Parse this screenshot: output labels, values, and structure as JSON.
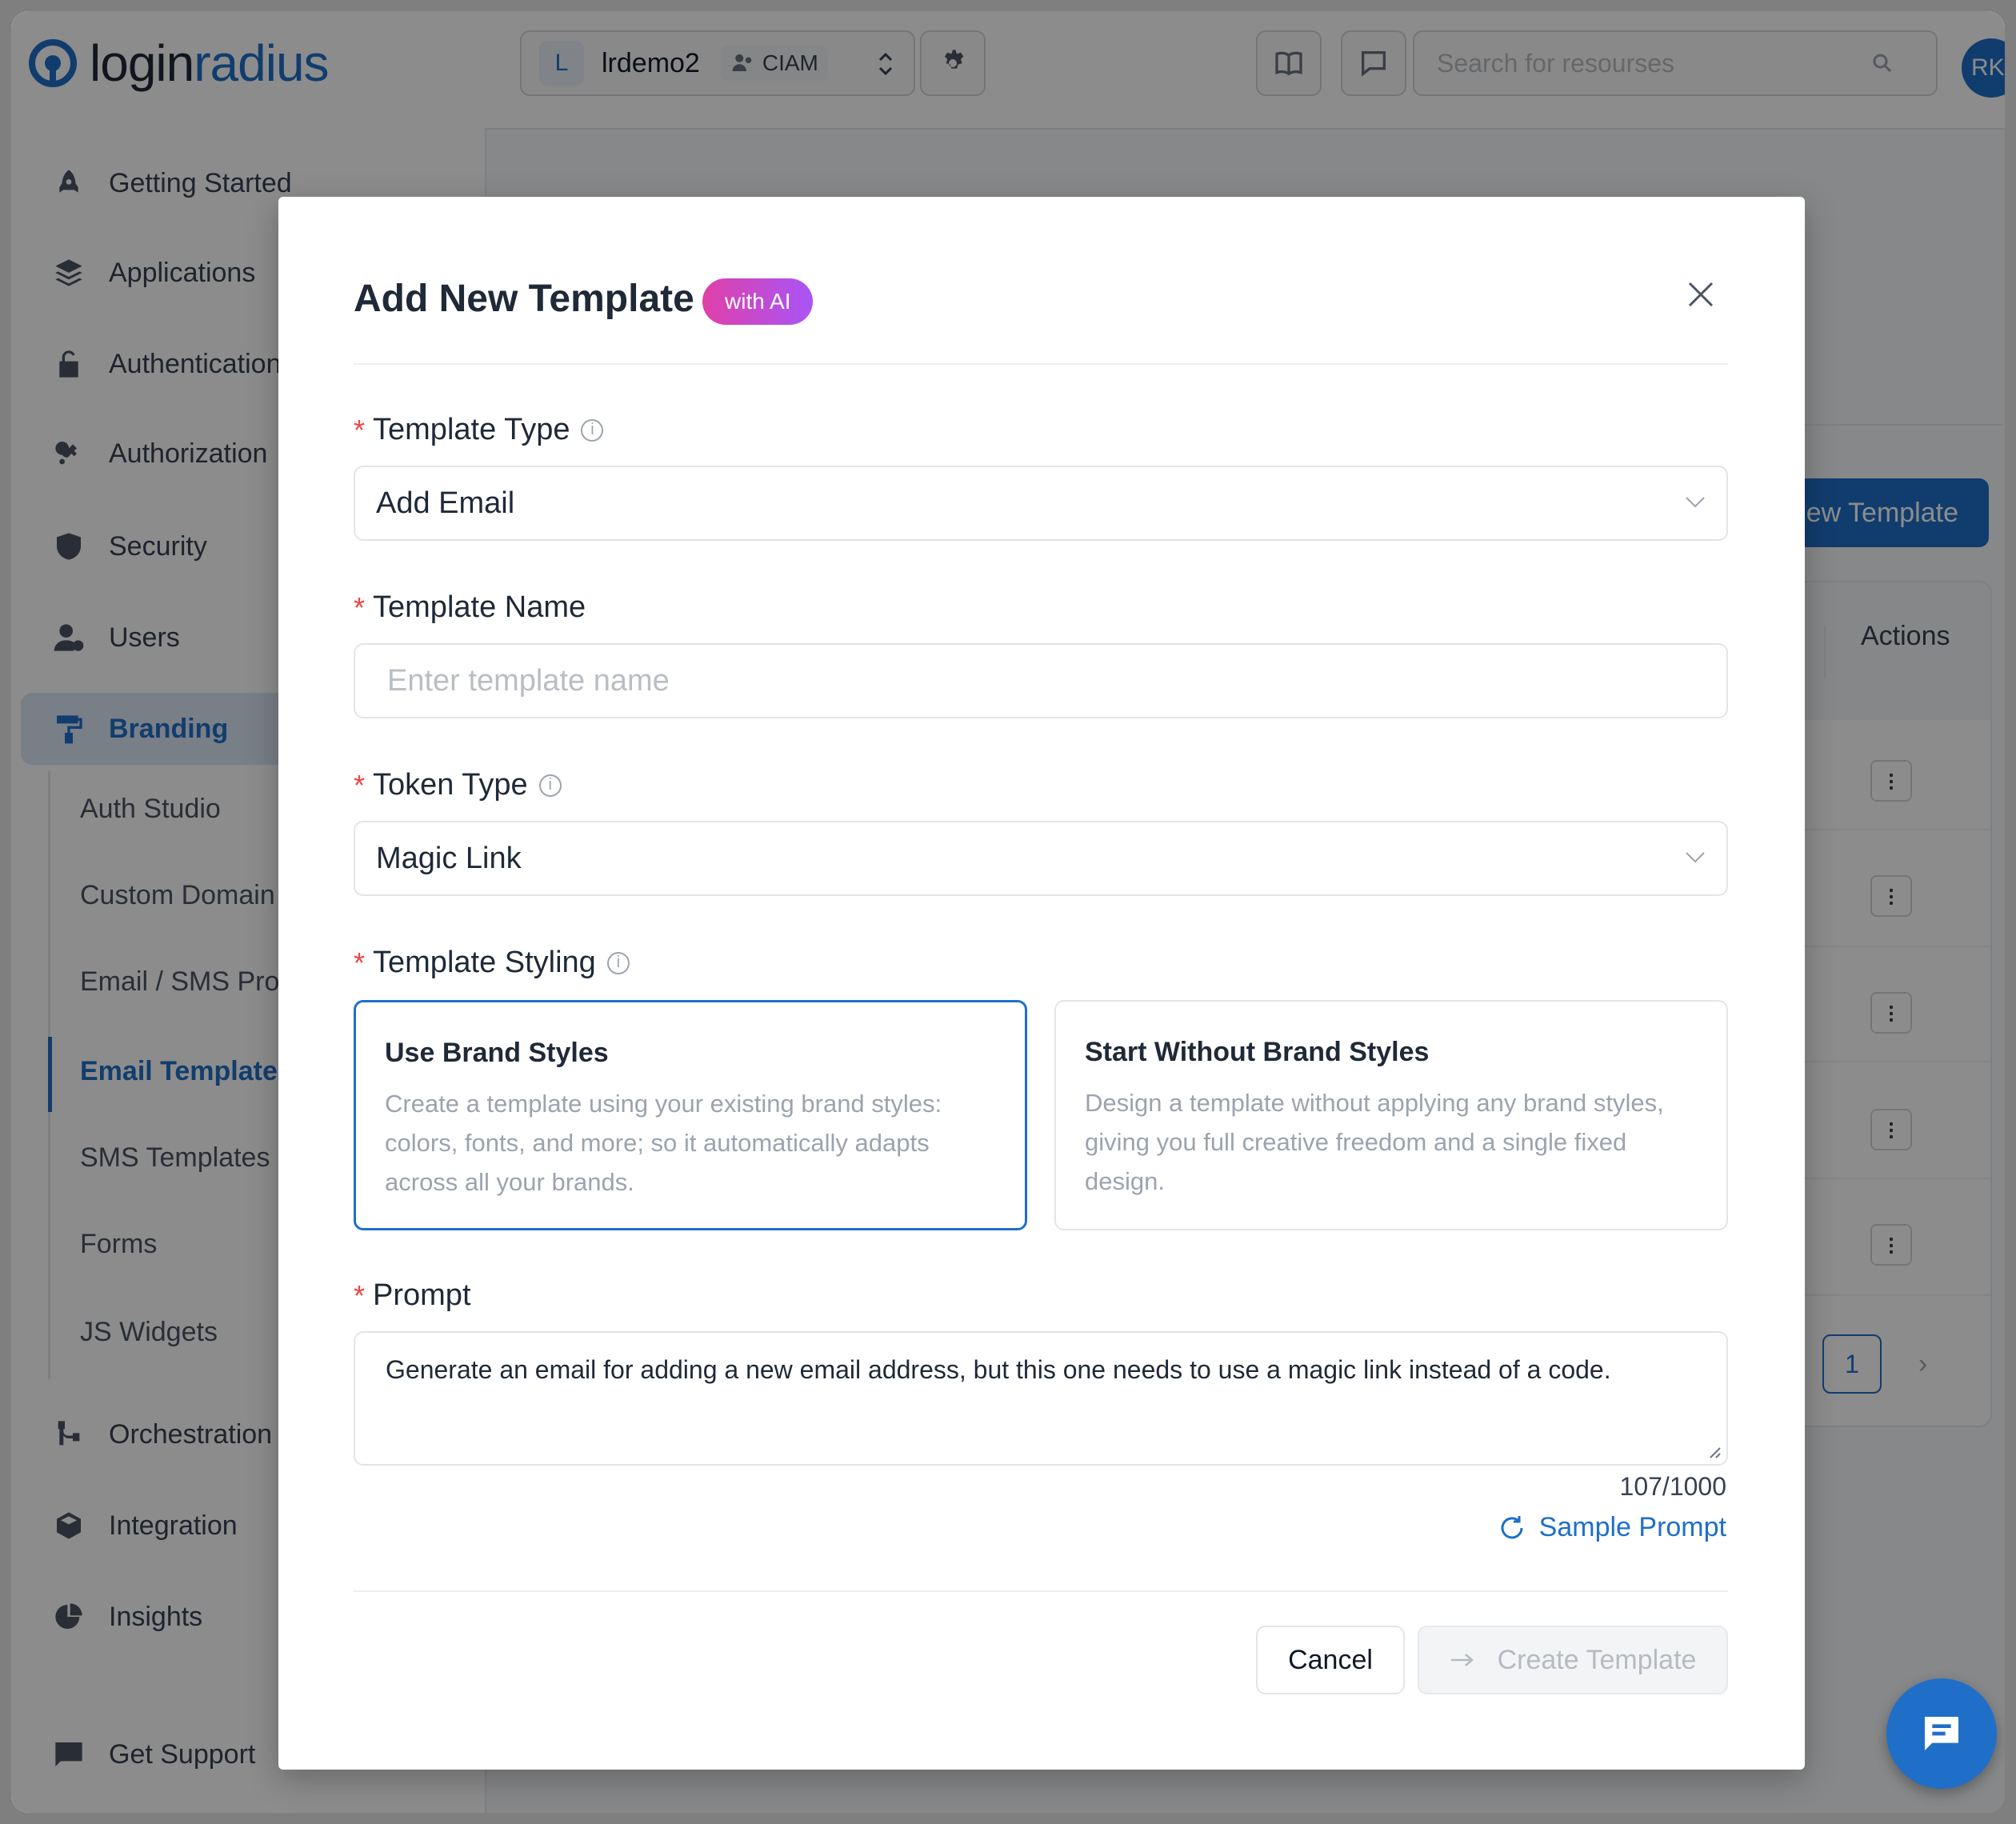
{
  "brand": {
    "name_part1": "login",
    "name_part2": "radius",
    "accent_color": "#1f6fc9"
  },
  "sidebar": {
    "items": [
      {
        "label": "Getting Started",
        "icon": "rocket-icon"
      },
      {
        "label": "Applications",
        "icon": "layers-icon"
      },
      {
        "label": "Authentication",
        "icon": "lock-icon"
      },
      {
        "label": "Authorization",
        "icon": "key-icon"
      },
      {
        "label": "Security",
        "icon": "shield-icon"
      },
      {
        "label": "Users",
        "icon": "users-icon"
      },
      {
        "label": "Branding",
        "icon": "paint-roller-icon",
        "active": true
      },
      {
        "label": "Orchestration",
        "icon": "branch-icon"
      },
      {
        "label": "Integration",
        "icon": "cube-icon"
      },
      {
        "label": "Insights",
        "icon": "pie-chart-icon"
      },
      {
        "label": "Get Support",
        "icon": "chat-bubble-icon"
      }
    ],
    "branding_sub": [
      {
        "label": "Auth Studio"
      },
      {
        "label": "Custom Domain"
      },
      {
        "label": "Email / SMS Pro"
      },
      {
        "label": "Email Template",
        "active": true
      },
      {
        "label": "SMS Templates"
      },
      {
        "label": "Forms"
      },
      {
        "label": "JS Widgets"
      }
    ]
  },
  "topbar": {
    "app_letter": "L",
    "app_name": "lrdemo2",
    "app_type": "CIAM",
    "search_placeholder": "Search for resourses",
    "avatar_initials": "RKI"
  },
  "background": {
    "new_template_label": "New Template",
    "table_header_actions": "Actions",
    "page_number": "1",
    "next_glyph": "›"
  },
  "modal": {
    "title": "Add New Template",
    "badge": "with AI",
    "fields": {
      "template_type": {
        "label": "Template Type",
        "value": "Add Email"
      },
      "template_name": {
        "label": "Template Name",
        "value": "",
        "placeholder": "Enter template name"
      },
      "token_type": {
        "label": "Token Type",
        "value": "Magic Link"
      },
      "template_styling": {
        "label": "Template Styling",
        "options": [
          {
            "title": "Use Brand Styles",
            "description": "Create a template using your existing brand styles: colors, fonts, and more; so it automatically adapts across all your brands.",
            "selected": true
          },
          {
            "title": "Start Without Brand Styles",
            "description": "Design a template without applying any brand styles, giving you full creative freedom and a single fixed design.",
            "selected": false
          }
        ]
      },
      "prompt": {
        "label": "Prompt",
        "value": "Generate an email for adding a new email address, but this one needs to use a magic link instead of a code.",
        "counter": "107/1000"
      }
    },
    "sample_prompt_label": "Sample Prompt",
    "cancel_label": "Cancel",
    "create_label": "Create Template",
    "required_mark": "*",
    "info_glyph": "i"
  }
}
